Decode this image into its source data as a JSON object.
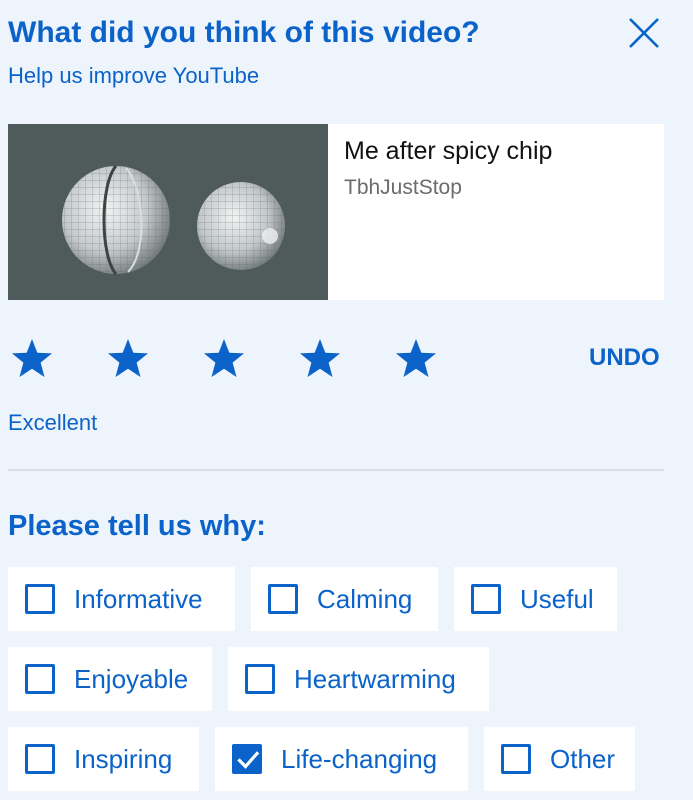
{
  "header": {
    "title": "What did you think of this video?",
    "subtitle": "Help us improve YouTube"
  },
  "video": {
    "title": "Me after spicy chip",
    "channel": "TbhJustStop"
  },
  "rating": {
    "value": 5,
    "max": 5,
    "label": "Excellent",
    "undo_label": "UNDO"
  },
  "reasons": {
    "heading": "Please tell us why:",
    "options": [
      {
        "label": "Informative",
        "checked": false
      },
      {
        "label": "Calming",
        "checked": false
      },
      {
        "label": "Useful",
        "checked": false
      },
      {
        "label": "Enjoyable",
        "checked": false
      },
      {
        "label": "Heartwarming",
        "checked": false
      },
      {
        "label": "Inspiring",
        "checked": false
      },
      {
        "label": "Life-changing",
        "checked": true
      },
      {
        "label": "Other",
        "checked": false
      }
    ]
  },
  "colors": {
    "accent": "#0b63c9",
    "background": "#eef4fc",
    "card": "#ffffff"
  },
  "icons": {
    "close": "close-icon",
    "star": "star-icon",
    "check": "check-icon"
  }
}
